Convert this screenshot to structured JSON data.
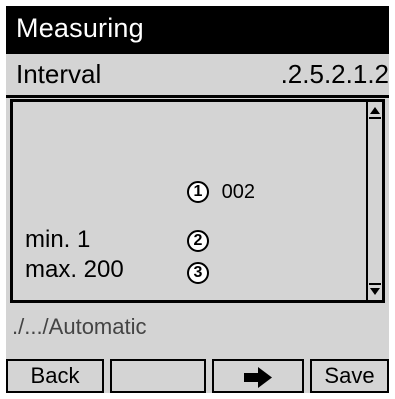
{
  "header": {
    "title": "Measuring"
  },
  "info": {
    "label": "Interval",
    "index": ".2.5.2.1.2"
  },
  "content": {
    "value_marker": "1",
    "value": "002",
    "min_label": "min. 1",
    "min_marker": "2",
    "max_label": "max. 200",
    "max_marker": "3"
  },
  "path": {
    "text": "./.../Automatic"
  },
  "buttons": {
    "back": "Back",
    "empty": "",
    "next_icon": "arrow-right",
    "save": "Save"
  }
}
